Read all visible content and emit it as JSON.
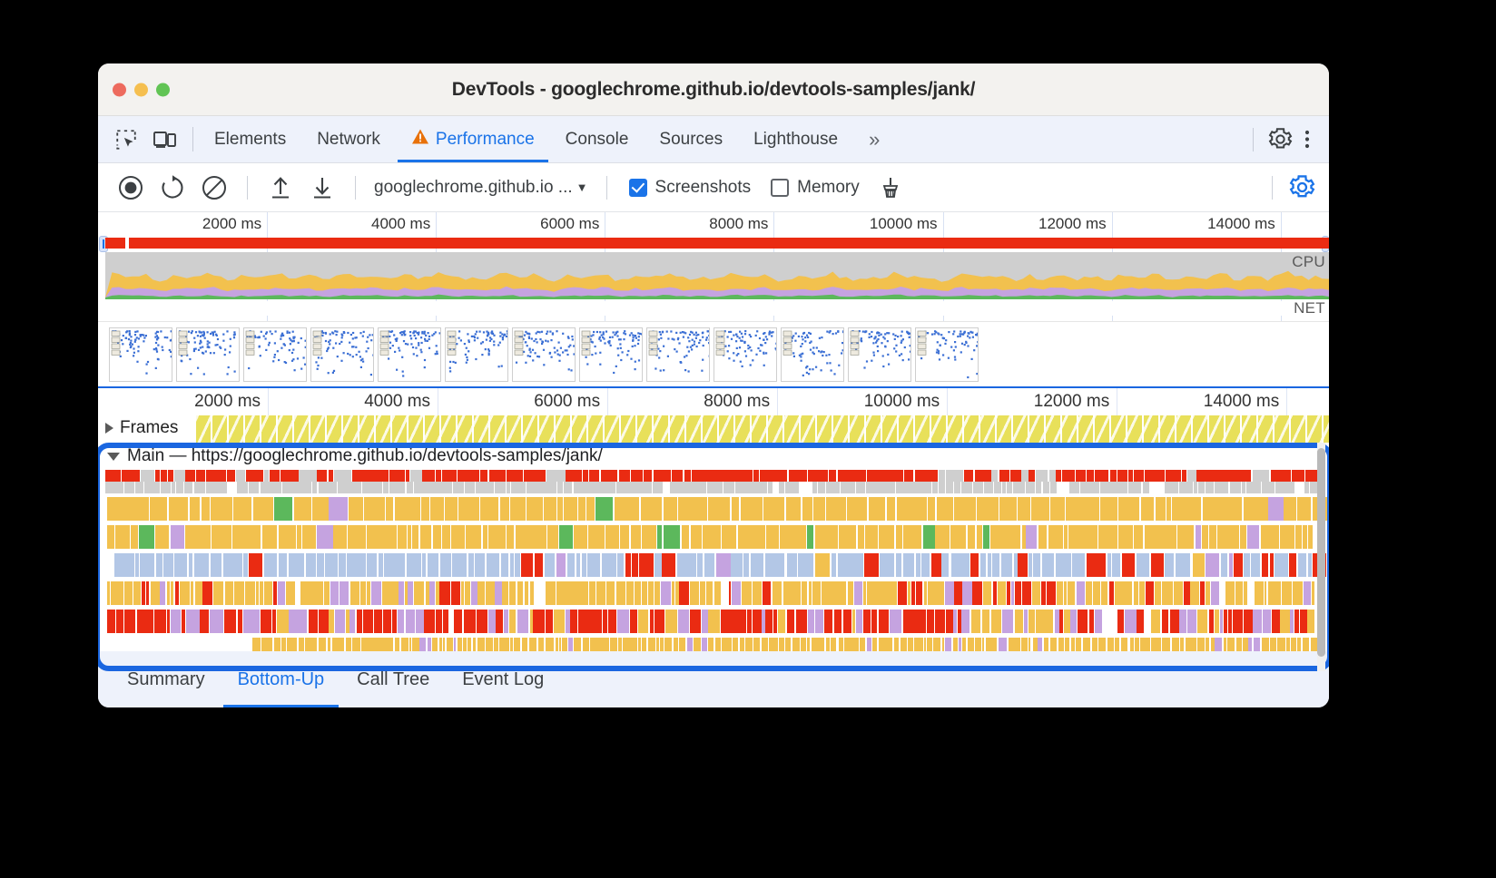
{
  "window": {
    "title": "DevTools - googlechrome.github.io/devtools-samples/jank/"
  },
  "tabstrip": {
    "icons": [
      "inspect-element-icon",
      "device-toolbar-icon"
    ],
    "tabs": [
      {
        "label": "Elements",
        "active": false,
        "warning": false
      },
      {
        "label": "Network",
        "active": false,
        "warning": false
      },
      {
        "label": "Performance",
        "active": true,
        "warning": true
      },
      {
        "label": "Console",
        "active": false,
        "warning": false
      },
      {
        "label": "Sources",
        "active": false,
        "warning": false
      },
      {
        "label": "Lighthouse",
        "active": false,
        "warning": false
      }
    ],
    "more_tabs": "»",
    "settings_icon": "gear-icon",
    "menu_icon": "kebab-menu-icon"
  },
  "perf_toolbar": {
    "record_icon": "record-circle-icon",
    "reload_icon": "reload-record-icon",
    "clear_icon": "clear-icon",
    "upload_icon": "upload-profile-icon",
    "download_icon": "download-profile-icon",
    "url_selector": "googlechrome.github.io ...",
    "screenshots_label": "Screenshots",
    "screenshots_checked": true,
    "memory_label": "Memory",
    "memory_checked": false,
    "garbage_icon": "collect-garbage-icon",
    "capture_settings_icon": "capture-settings-gear-icon"
  },
  "overview": {
    "ticks": [
      "2000 ms",
      "4000 ms",
      "6000 ms",
      "8000 ms",
      "10000 ms",
      "12000 ms",
      "14000 ms"
    ],
    "cpu_label": "CPU",
    "net_label": "NET",
    "screenshot_count": 13
  },
  "flame": {
    "ticks": [
      "2000 ms",
      "4000 ms",
      "6000 ms",
      "8000 ms",
      "10000 ms",
      "12000 ms",
      "14000 ms"
    ],
    "frames_label": "Frames",
    "main_label": "Main — https://googlechrome.github.io/devtools-samples/jank/",
    "highlight_color": "#1a66e0"
  },
  "bottom_tabs": [
    {
      "label": "Summary",
      "active": false
    },
    {
      "label": "Bottom-Up",
      "active": true
    },
    {
      "label": "Call Tree",
      "active": false
    },
    {
      "label": "Event Log",
      "active": false
    }
  ],
  "colors": {
    "accent": "#1a73e8",
    "warning": "#e8710a",
    "scripting": "#f2c14e",
    "rendering": "#c5a3e0",
    "painting": "#5cb85c",
    "loading": "#b3c7e6",
    "long_task": "#ea2b12",
    "frames": "#e8e05a"
  }
}
